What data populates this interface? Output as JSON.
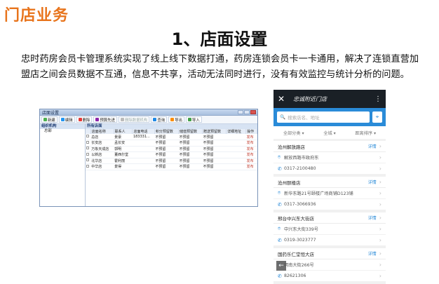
{
  "header": {
    "title": "门店业务"
  },
  "slide": {
    "heading": "1、店面设置",
    "body": "忠时药房会员卡管理系统实现了线上线下数据打通，药房连锁会员卡一卡通用，解决了连锁直营加盟店之间会员数据不互通，信息不共享，活动无法同时进行，没有有效监控与统计分析的问题。"
  },
  "desktop_window": {
    "title": "店面设置",
    "toolbar": [
      {
        "label": "新建",
        "icon": "new-icon",
        "color": "#4caf50"
      },
      {
        "label": "编辑",
        "icon": "edit-icon",
        "color": "#2196f3"
      },
      {
        "label": "删除",
        "icon": "delete-icon",
        "color": "#e53935"
      },
      {
        "label": "预算先进",
        "icon": "budget-icon",
        "color": "#8e24aa"
      },
      {
        "label": "删除数据机构",
        "icon": "remove-org-icon",
        "color": "#bbbbbb",
        "disabled": true
      },
      {
        "label": "查询",
        "icon": "query-icon",
        "color": "#1e88e5"
      },
      {
        "label": "导出",
        "icon": "export-icon",
        "color": "#fb8c00"
      },
      {
        "label": "导入",
        "icon": "import-icon",
        "color": "#43a047"
      }
    ],
    "tree": {
      "header": "组织机构",
      "items": [
        "总部"
      ]
    },
    "grid": {
      "header": "所有店面",
      "columns": [
        "",
        "店面名称",
        "联系人",
        "店面电话",
        "积分预留数",
        "储值预留数",
        "赠送预留数",
        "详细地址",
        "操作"
      ],
      "rows": [
        [
          "",
          "总店",
          "景豪",
          "183331...",
          "不预留",
          "不预留",
          "不预留",
          "",
          "发布"
        ],
        [
          "",
          "长安店",
          "孟长安",
          "",
          "不预留",
          "不预留",
          "不预留",
          "",
          "发布"
        ],
        [
          "",
          "万象天成店",
          "郭明",
          "",
          "不预留",
          "不预留",
          "不预留",
          "",
          "发布"
        ],
        [
          "",
          "以新店",
          "董西尔堂",
          "",
          "不预留",
          "不预留",
          "不预留",
          "",
          "发布"
        ],
        [
          "",
          "北华店",
          "霍利丽",
          "",
          "不预留",
          "不预留",
          "不预留",
          "",
          "发布"
        ],
        [
          "",
          "中华店",
          "景得",
          "",
          "不预留",
          "不预留",
          "不预留",
          "",
          "发布"
        ]
      ]
    }
  },
  "phone": {
    "title": "忠诚附近门店",
    "search_placeholder": "搜索店名、地址",
    "filters": [
      "全部分类",
      "全城",
      "距离排序"
    ],
    "detail_label": "详情",
    "stores": [
      {
        "name": "沧州解放路店",
        "address": "解放西路市政府东",
        "phone": "0317-2100480"
      },
      {
        "name": "沧州颐楼店",
        "address": "新华东路21号颐楼广场商铺D123铺",
        "phone": "0317-3066936"
      },
      {
        "name": "邢台中兴东大街店",
        "address": "中兴东大街339号",
        "phone": "0319-3023777"
      },
      {
        "name": "国药乐仁堂恒大店",
        "address": "明南大街266号",
        "phone": "82621306"
      }
    ]
  }
}
